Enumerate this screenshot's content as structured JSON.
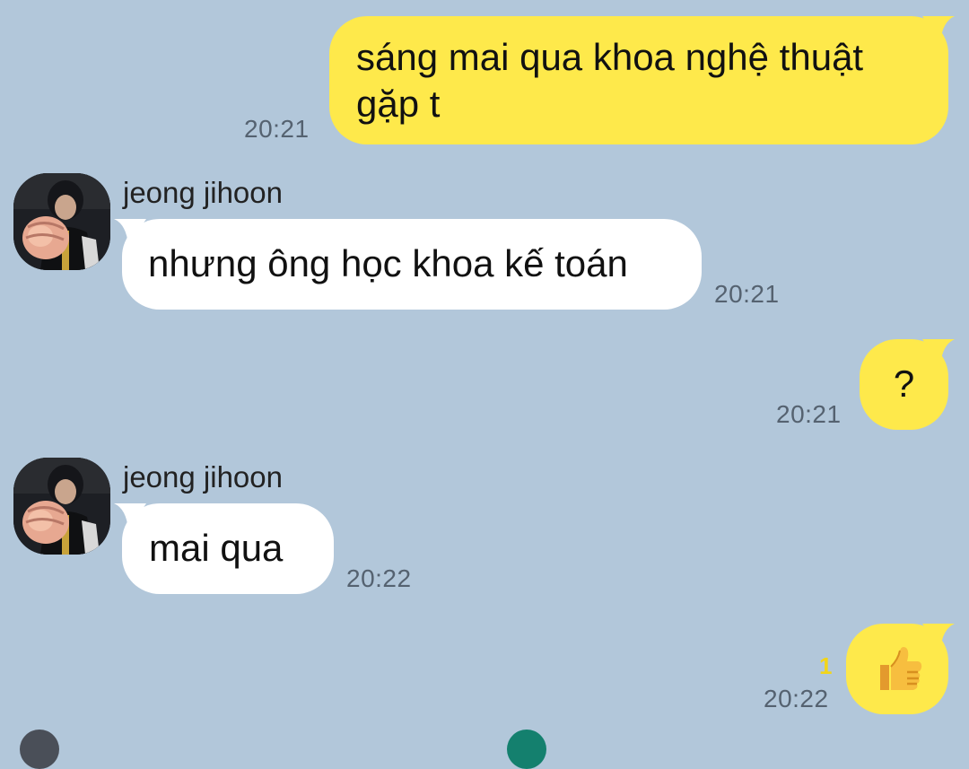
{
  "conversation": {
    "messages": [
      {
        "from": "me",
        "text": "sáng mai qua khoa nghệ thuật gặp t",
        "time": "20:21"
      },
      {
        "from": "them",
        "sender": "jeong jihoon",
        "text": "nhưng ông học khoa kế toán",
        "time": "20:21"
      },
      {
        "from": "me",
        "text": "?",
        "time": "20:21"
      },
      {
        "from": "them",
        "sender": "jeong jihoon",
        "text": "mai qua",
        "time": "20:22"
      },
      {
        "from": "me",
        "text": "👍",
        "time": "20:22",
        "unread": "1"
      }
    ]
  },
  "colors": {
    "background": "#b2c7da",
    "my_bubble": "#fee94b",
    "their_bubble": "#ffffff",
    "timestamp": "#556270",
    "unread_count": "#f2d51a"
  },
  "icons": {
    "avatar": "profile-photo",
    "thumbs_up": "thumbs-up-emoji"
  }
}
